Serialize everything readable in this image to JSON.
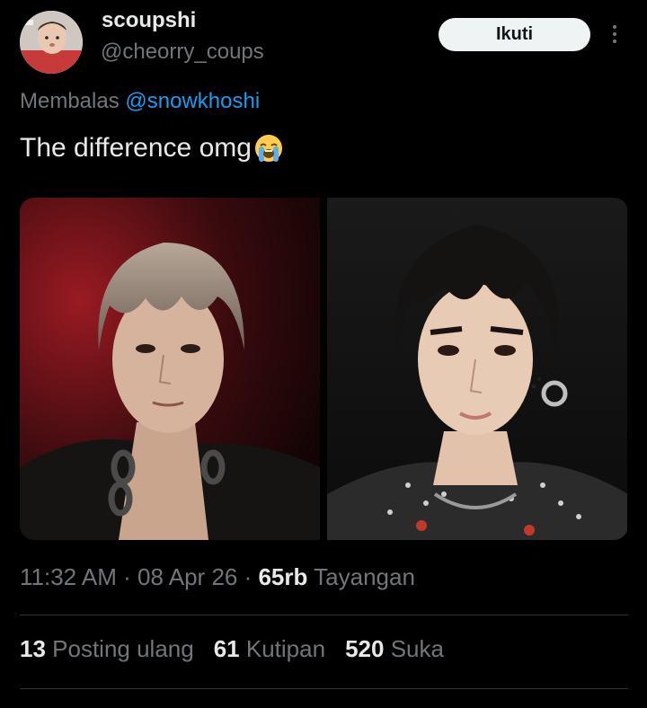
{
  "user": {
    "display_name": "scoupshi",
    "handle": "@cheorry_coups"
  },
  "follow_label": "Ikuti",
  "reply": {
    "prefix": "Membalas",
    "mention": "@snowkhoshi"
  },
  "tweet_text": "The difference omg",
  "emoji_name": "loudly-crying-face",
  "meta": {
    "time": "11:32 AM",
    "sep1": " · ",
    "date": "08 Apr 26",
    "sep2": " · ",
    "views_count": "65rb",
    "views_label": "Tayangan"
  },
  "stats": {
    "reposts_count": "13",
    "reposts_label": "Posting ulang",
    "quotes_count": "61",
    "quotes_label": "Kutipan",
    "likes_count": "520",
    "likes_label": "Suka"
  },
  "colors": {
    "background": "#000000",
    "text_primary": "#e7e9ea",
    "text_secondary": "#71767b",
    "link": "#1d9bf0",
    "divider": "#2f3336",
    "follow_button_bg": "#eff3f4"
  }
}
